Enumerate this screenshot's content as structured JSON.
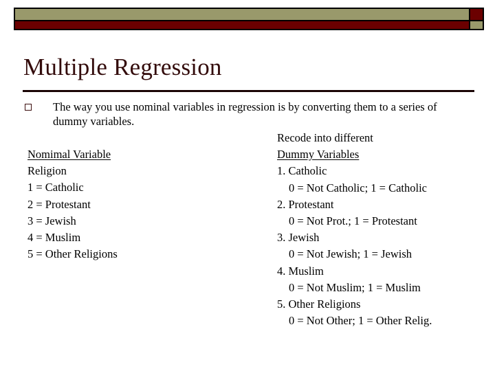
{
  "banner": {
    "top_band_color": "#99996b",
    "bottom_band_color": "#6b0000",
    "outline_color": "#000000"
  },
  "slide": {
    "title": "Multiple Regression",
    "title_color": "#330b0b",
    "rule_color": "#1a0505"
  },
  "bullet": {
    "marker": "hollow-square-bullet",
    "marker_color": "#3b0d0d",
    "text": "The way you use nominal variables in regression is by converting them to a series of dummy variables."
  },
  "left_column": {
    "heading": "Nomimal Variable",
    "subheading": "Religion",
    "items": [
      "1 = Catholic",
      "2 = Protestant",
      "3 = Jewish",
      "4 = Muslim",
      "5 = Other Religions"
    ]
  },
  "right_column": {
    "intro": "Recode into different",
    "heading": "Dummy Variables",
    "entries": [
      {
        "label": "1. Catholic",
        "coding": "0 = Not Catholic; 1 = Catholic"
      },
      {
        "label": "2. Protestant",
        "coding": "0 = Not Prot.; 1 = Protestant"
      },
      {
        "label": "3. Jewish",
        "coding": "0 = Not Jewish; 1 = Jewish"
      },
      {
        "label": "4. Muslim",
        "coding": "0 = Not Muslim; 1 = Muslim"
      },
      {
        "label": "5. Other Religions",
        "coding": "0 = Not Other; 1 = Other Relig."
      }
    ]
  }
}
